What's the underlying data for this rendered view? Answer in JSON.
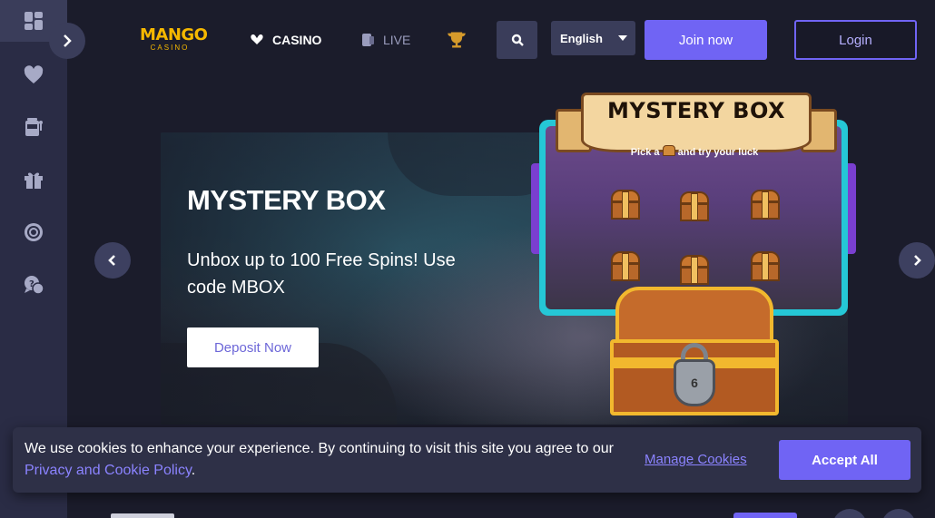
{
  "header": {
    "logo_top": "MANGO",
    "logo_bottom": "CASINO",
    "nav_casino": "CASINO",
    "nav_live": "LIVE",
    "language": "English",
    "join_label": "Join now",
    "login_label": "Login"
  },
  "sidebar": {
    "items": [
      {
        "icon": "dashboard-icon"
      },
      {
        "icon": "heart-icon"
      },
      {
        "icon": "slot-machine-icon"
      },
      {
        "icon": "gift-icon"
      },
      {
        "icon": "lifebuoy-icon"
      },
      {
        "icon": "support-chat-icon"
      }
    ]
  },
  "banner": {
    "title": "MYSTERY BOX",
    "description": "Unbox up to 100 Free Spins! Use code MBOX",
    "cta_label": "Deposit Now",
    "art_title": "MYSTERY BOX",
    "art_subtitle": "Pick a",
    "art_subtitle_end": "and try your luck",
    "lock_number": "6"
  },
  "cookie": {
    "text_before": "We use cookies to enhance your experience. By continuing to visit this site you agree to our ",
    "policy_link": "Privacy and Cookie Policy",
    "text_after": ".",
    "manage_label": "Manage Cookies",
    "accept_label": "Accept All"
  },
  "colors": {
    "accent": "#7064f4",
    "background": "#1b1c2b",
    "sidebar": "#2a2c45",
    "logo": "#f5b800"
  }
}
